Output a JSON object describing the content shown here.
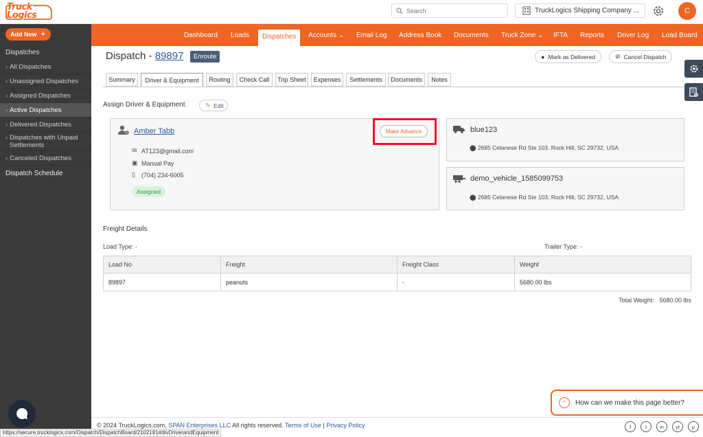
{
  "header": {
    "logo_line1": "Truck",
    "logo_line2": "Logics",
    "search_placeholder": "Search",
    "company": "TruckLogics Shipping Company ...",
    "avatar_initial": "C"
  },
  "sidebar": {
    "add_new": "Add New",
    "heading": "Dispatches",
    "items": [
      {
        "label": "All Dispatches"
      },
      {
        "label": "Unassigned Dispatches"
      },
      {
        "label": "Assigned Dispatches"
      },
      {
        "label": "Active Dispatches"
      },
      {
        "label": "Delivered Dispatches"
      },
      {
        "label": "Dispatches with Unpaid Settlements"
      },
      {
        "label": "Canceled Dispatches"
      }
    ],
    "schedule": "Dispatch Schedule"
  },
  "nav": {
    "items": [
      "Dashboard",
      "Loads",
      "Dispatches",
      "Accounts",
      "Email Log",
      "Address Book",
      "Documents",
      "Truck Zone",
      "IFTA",
      "Reports",
      "Driver Log",
      "Load Board"
    ],
    "active": "Dispatches"
  },
  "dispatch": {
    "title_prefix": "Dispatch -",
    "number": "89897",
    "status": "Enroute",
    "mark_delivered": "Mark as Delivered",
    "cancel": "Cancel Dispatch"
  },
  "tabs": [
    "Summary",
    "Driver & Equipment",
    "Routing",
    "Check Call",
    "Trip Sheet",
    "Expenses",
    "Settlements",
    "Documents",
    "Notes"
  ],
  "assign": {
    "title": "Assign Driver & Equipment",
    "edit": "Edit"
  },
  "driver": {
    "name": "Amber Tabb",
    "email": "AT123@gmail.com",
    "pay": "Manual Pay",
    "phone": "(704) 234-6005",
    "status": "Assigned",
    "advance_button": "Make Advance"
  },
  "truck": {
    "name": "blue123",
    "address": "2685 Celanese Rd Ste 103, Rock Hill, SC 29732, USA"
  },
  "trailer": {
    "name": "demo_vehicle_1585099753",
    "address": "2685 Celanese Rd Ste 103, Rock Hill, SC 29732, USA"
  },
  "freight": {
    "title": "Freight Details",
    "load_type": "Load Type: -",
    "trailer_type": "Trailer Type: -",
    "columns": [
      "Load No",
      "Freight",
      "Freight Class",
      "Weight"
    ],
    "rows": [
      [
        "89897",
        "peanuts",
        "-",
        "5680.00 lbs"
      ]
    ],
    "total_label": "Total Weight:",
    "total_value": "5680.00 lbs"
  },
  "feedback": "How can we make this page better?",
  "footer": {
    "copyright": "© 2024 TruckLogics.com,",
    "company_link": "SPAN Enterprises LLC",
    "rights": "All rights reserved.",
    "terms": "Terms of Use",
    "separator": "|",
    "privacy": "Privacy Policy",
    "social": [
      "f",
      "t",
      "in",
      "yt",
      "p"
    ]
  },
  "status_url": "https://secure.trucklogics.com/Dispatch/DispatchBoard/2102181#divDriverandEquipment",
  "colors": {
    "brand_orange": "#f06424",
    "sidebar_bg": "#3a3a3a",
    "highlight_red": "#e8172b",
    "link_blue": "#2a5a9a"
  }
}
